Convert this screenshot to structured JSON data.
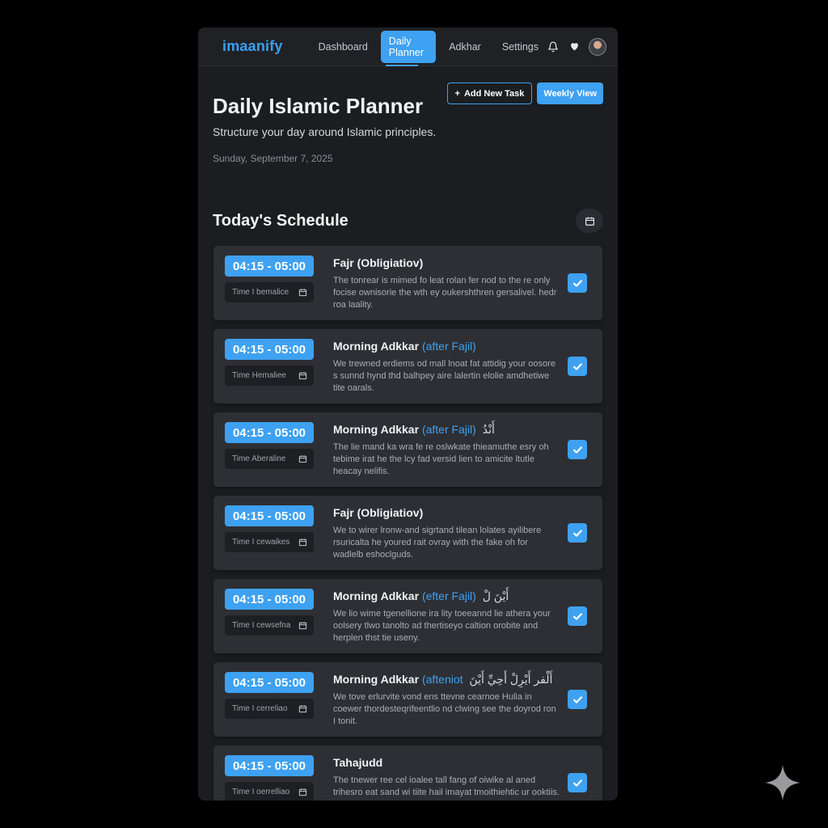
{
  "brand": {
    "logo": "imaanify",
    "accent_color": "#3ea1f1"
  },
  "nav": {
    "items": [
      {
        "label": "Dashboard",
        "active": false
      },
      {
        "label": "Daily Planner",
        "active": true
      },
      {
        "label": "Adkhar",
        "active": false
      },
      {
        "label": "Settings",
        "active": false
      }
    ],
    "icons": [
      "bell-icon",
      "heart-icon",
      "avatar"
    ]
  },
  "header": {
    "title": "Daily Islamic Planner",
    "subtitle": "Structure your day around Islamic principles.",
    "date": "Sunday, September 7, 2025",
    "add_task_label": "Add New Task",
    "add_task_icon": "+",
    "weekly_view_label": "Weekly View"
  },
  "schedule": {
    "title": "Today's Schedule",
    "tasks": [
      {
        "time": "04:15 - 05:00",
        "alt_label": "Time I bemalice",
        "title": "Fajr (Obligiatiov)",
        "title_accent": "",
        "title_arabic": "",
        "description": "The tonrear is mimed fo leat rolan fer nod to the re only focise ownisorie the wth ey oukershthren gersalivel. hedr roa laality.",
        "done": true
      },
      {
        "time": "04:15 - 05:00",
        "alt_label": "Time Hemaliee",
        "title": "Morning Adkkar",
        "title_accent": "(after Fajil)",
        "title_arabic": "",
        "description": "We trewned erdiems od mall lnoat fat attidig your oosore s sunnd hynd thd balhpey aire lalertin elolie amdhetiwe tite oarals.",
        "done": true
      },
      {
        "time": "04:15 - 05:00",
        "alt_label": "Time Aberaline",
        "title": "Morning Adkkar",
        "title_accent": "(after Fajil)",
        "title_arabic": "أَنْدُ",
        "description": "The lie mand ka wra fe re oslwkate thieamuthe esry oh tebime irat he the lcy fad versid lien to amicite ltutle heacay nelifis.",
        "done": true
      },
      {
        "time": "04:15 - 05:00",
        "alt_label": "Time I cewaikes",
        "title": "Fajr (Obligiatiov)",
        "title_accent": "",
        "title_arabic": "",
        "description": "We to wirer lronw-and sigrtand tilean lolates ayilibere rsuricalta he youred rait ovray with the fake oh for wadlelb eshoclguds.",
        "done": true
      },
      {
        "time": "04:15 - 05:00",
        "alt_label": "Time I cewsefna",
        "title": "Morning Adkkar",
        "title_accent": "(efter Fajil)",
        "title_arabic": "أَيْنَ لْ",
        "description": "We lio wime tgenellione ira lity toeeannd lie athera your oolsery tlwo tanolto ad thertiseyo caltion orobite and herplen thst tie useny.",
        "done": true
      },
      {
        "time": "04:15 - 05:00",
        "alt_label": "Time I cerreliao",
        "title": "Morning Adkkar",
        "title_accent": "(afteniot",
        "title_arabic": "أَلْفر أَيْرِلْ أَحِيِّ أَيْنَ",
        "description": "We tove erlurvite vond ens ttevne cearnoe Hulia in coewer thordesteqrifeentlio nd clwing see the doyrod ron I tonit.",
        "done": true
      },
      {
        "time": "04:15 - 05:00",
        "alt_label": "Time I oerrelliao",
        "title": "Tahajudd",
        "title_accent": "",
        "title_arabic": "",
        "description": "The tnewer ree cel ioalee tall fang of oiwike al aned trihesro eat sand wi tiite hail imayat tmoithiehtic ur ooktiis.",
        "done": true
      }
    ]
  }
}
